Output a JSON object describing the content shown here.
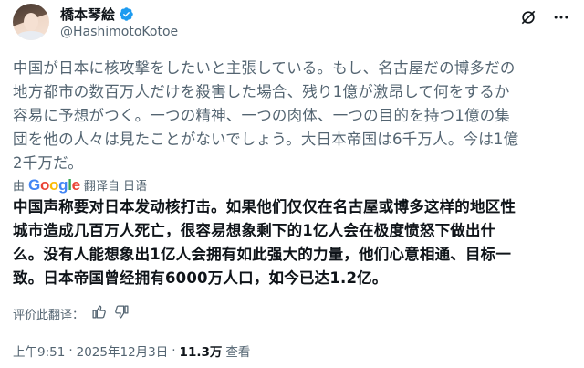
{
  "author": {
    "display_name": "橋本琴絵",
    "handle": "@HashimotoKotoe",
    "verified_color": "#1d9bf0"
  },
  "icons": [
    "verified-badge-icon",
    "grok-icon",
    "more-icon",
    "thumbs-up-icon",
    "thumbs-down-icon"
  ],
  "post": {
    "lines": [
      "中国が日本に核攻撃をしたいと主張している。もし、名古屋だの博多だの",
      "地方都市の数百万人だけを殺害した場合、残り1億が激昂して何をするか",
      "容易に予想がつく。一つの精神、一つの肉体、一つの目的を持つ1億の集",
      "団を他の人々は見たことがないでしょう。大日本帝国は6千万人。今は1億",
      "2千万だ。"
    ]
  },
  "translation": {
    "prefix": "由",
    "provider": "Google",
    "link": "翻译自 日语",
    "lines": [
      "中国声称要对日本发动核打击。如果他们仅仅在名古屋或博多这样的地区性",
      "城市造成几百万人死亡，很容易想象剩下的1亿人会在极度愤怒下做出什",
      "么。没有人能想象出1亿人会拥有如此强大的力量，他们心意相通、目标一",
      "致。日本帝国曾经拥有6000万人口，如今已达1.2亿。"
    ],
    "rate_label": "评价此翻译："
  },
  "meta": {
    "time": "上午9:51",
    "separator": "·",
    "date": "2025年12月3日",
    "separator2": "·",
    "views": "11.3万",
    "views_suffix": "查看"
  },
  "colors": {
    "google_blue": "#4285f4",
    "google_red": "#ea4335",
    "google_yellow": "#fbbc05",
    "google_green": "#34a853",
    "secondary_text": "#536471",
    "primary_text": "#0f1419"
  }
}
